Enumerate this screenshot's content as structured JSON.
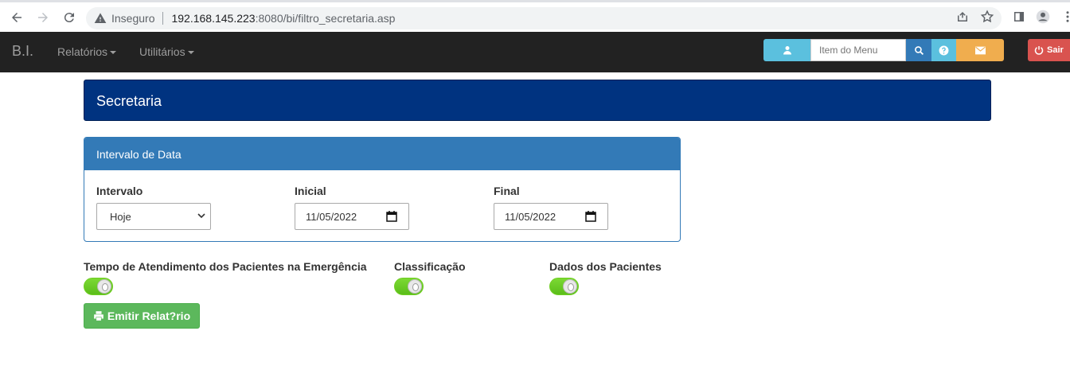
{
  "browser": {
    "security_label": "Inseguro",
    "url_host": "192.168.145.223",
    "url_path": ":8080/bi/filtro_secretaria.asp"
  },
  "navbar": {
    "brand": "B.I.",
    "menus": [
      {
        "label": "Relatórios"
      },
      {
        "label": "Utilitários"
      }
    ],
    "search_placeholder": "Item do Menu",
    "exit_label": "Sair"
  },
  "page": {
    "title": "Secretaria"
  },
  "date_panel": {
    "heading": "Intervalo de Data",
    "interval_label": "Intervalo",
    "interval_value": "Hoje",
    "initial_label": "Inicial",
    "initial_value": "11/05/2022",
    "final_label": "Final",
    "final_value": "11/05/2022"
  },
  "options": [
    {
      "label": "Tempo de Atendimento dos Pacientes na Emergência",
      "enabled": true
    },
    {
      "label": "Classificação",
      "enabled": true
    },
    {
      "label": "Dados dos Pacientes",
      "enabled": true
    }
  ],
  "emit_button_label": "Emitir Relat?rio",
  "colors": {
    "navbar": "#222222",
    "title_panel": "#003380",
    "panel_primary": "#337ab7",
    "info": "#5bc0de",
    "warning": "#f0ad4e",
    "danger": "#d9534f",
    "success": "#5cb85c"
  },
  "icons": {
    "user": "user-icon",
    "search": "search-icon",
    "help": "question-circle-icon",
    "mail": "envelope-icon",
    "exit": "power-icon",
    "print": "print-icon"
  }
}
